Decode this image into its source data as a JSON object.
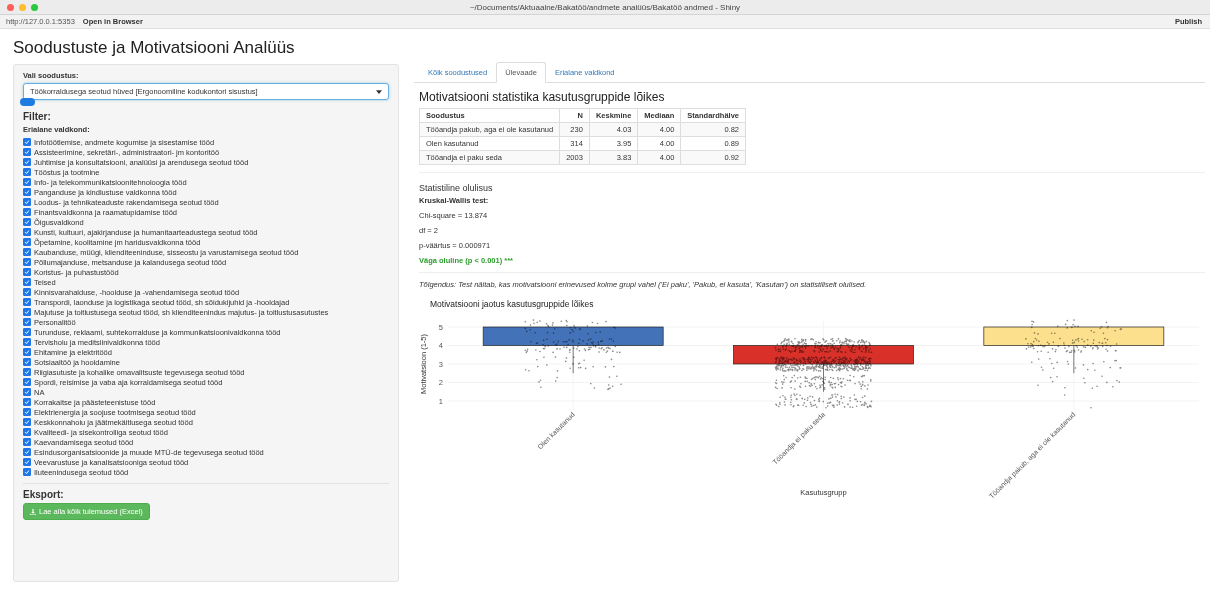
{
  "window": {
    "title": "~/Documents/Aktuaalne/Bakatöö/andmete analüüs/Bakatöö andmed - Shiny"
  },
  "toolbar": {
    "url": "http://127.0.0.1:5353",
    "open_button": "Open in Browser",
    "publish_button": "Publish"
  },
  "page_title": "Soodustuste ja Motivatsiooni Analüüs",
  "sidebar": {
    "select_label": "Vali soodustus:",
    "select_value": "Töökorraldusega seotud hüved [Ergonoomiline kodukontori sisustus]",
    "filter_heading": "Filter:",
    "group_label": "Erialane valdkond:",
    "options": [
      {
        "label": "Infotöötlemise, andmete kogumise ja sisestamise tööd",
        "checked": true
      },
      {
        "label": "Assisteerimine, sekretäri-, administraatori- jm kontoritöö",
        "checked": true
      },
      {
        "label": "Juhtimise ja konsultatsiooni, analüüsi ja arendusega seotud tööd",
        "checked": true
      },
      {
        "label": "Tööstus ja tootmine",
        "checked": true
      },
      {
        "label": "Info- ja telekommunikatsioonitehnoloogia tööd",
        "checked": true
      },
      {
        "label": "Panganduse ja kindlustuse valdkonna tööd",
        "checked": true
      },
      {
        "label": "Loodus- ja tehnikateaduste rakendamisega seotud tööd",
        "checked": true
      },
      {
        "label": "Finantsvaldkonna ja raamatupidamise tööd",
        "checked": true
      },
      {
        "label": "Õigusvaldkond",
        "checked": true
      },
      {
        "label": "Kunsti, kultuuri, ajakirjanduse ja humanitaarteadustega seotud tööd",
        "checked": true
      },
      {
        "label": "Õpetamine, koolitamine jm haridusvaldkonna tööd",
        "checked": true
      },
      {
        "label": "Kaubanduse, müügi, klienditeeninduse, sisseostu ja varustamisega seotud tööd",
        "checked": true
      },
      {
        "label": "Põllumajanduse, metsanduse ja kalandusega seotud tööd",
        "checked": true
      },
      {
        "label": "Koristus- ja puhastustööd",
        "checked": true
      },
      {
        "label": "Teised",
        "checked": true
      },
      {
        "label": "Kinnisvarahalduse, -hoolduse ja -vahendamisega seotud tööd",
        "checked": true
      },
      {
        "label": "Transpordi, laonduse ja logistikaga seotud tööd, sh sõidukijuhid ja -hooldajad",
        "checked": true
      },
      {
        "label": "Majutuse ja toitlustusega seotud tööd, sh klienditeenindus majutus- ja toitlustusasutustes",
        "checked": true
      },
      {
        "label": "Personalitöö",
        "checked": true
      },
      {
        "label": "Turunduse, reklaami, suhtekorralduse ja kommunikatsioonivaldkonna tööd",
        "checked": true
      },
      {
        "label": "Tervishoiu ja meditsiinivaldkonna tööd",
        "checked": true
      },
      {
        "label": "Ehitamine ja elektritööd",
        "checked": true
      },
      {
        "label": "Sotsiaaltöö ja hooldamine",
        "checked": true
      },
      {
        "label": "Riigiasutuste ja kohalike omavalitsuste tegevusega seotud tööd",
        "checked": true
      },
      {
        "label": "Spordi, reisimise ja vaba aja korraldamisega seotud tööd",
        "checked": true
      },
      {
        "label": "NA",
        "checked": true
      },
      {
        "label": "Korrakaitse ja päästeteenistuse tööd",
        "checked": true
      },
      {
        "label": "Elektrienergia ja soojuse tootmisega seotud tööd",
        "checked": true
      },
      {
        "label": "Keskkonnahoiu ja jäätmekäitlusega seotud tööd",
        "checked": true
      },
      {
        "label": "Kvaliteedi- ja sisekontrolliga seotud tööd",
        "checked": true
      },
      {
        "label": "Kaevandamisega seotud tööd",
        "checked": true
      },
      {
        "label": "Esindusorganisatsioonide ja muude MTÜ-de tegevusega seotud tööd",
        "checked": true
      },
      {
        "label": "Veevarustuse ja kanalisatsiooniga seotud tööd",
        "checked": true
      },
      {
        "label": "Iluteenindusega seotud tööd",
        "checked": true
      }
    ],
    "export_heading": "Eksport:",
    "download_button": "Lae alla kõik tulemused (Excel)"
  },
  "tabs": [
    {
      "label": "Kõik soodustused",
      "selected": false
    },
    {
      "label": "Ülevaade",
      "selected": true
    },
    {
      "label": "Erialane valdkond",
      "selected": false
    }
  ],
  "stats_title": "Motivatsiooni statistika kasutusgruppide lõikes",
  "table": {
    "columns": [
      "Soodustus",
      "N",
      "Keskmine",
      "Mediaan",
      "Standardhälve"
    ],
    "rows": [
      [
        "Tööandja pakub, aga ei ole kasutanud",
        "230",
        "4.03",
        "4.00",
        "0.82"
      ],
      [
        "Olen kasutanud",
        "314",
        "3.95",
        "4.00",
        "0.89"
      ],
      [
        "Tööandja ei paku seda",
        "2003",
        "3.83",
        "4.00",
        "0.92"
      ]
    ]
  },
  "significance": {
    "heading": "Statistiline olulisus",
    "test": "Kruskal-Wallis test:",
    "lines": [
      "Chi-square = 13.874",
      "df = 2",
      "p-väärtus = 0.000971"
    ],
    "verdict": "Väga oluline (p < 0.001) ***"
  },
  "interpretation": "Tõlgendus: Test näitab, kas motivatsiooni erinevused kolme grupi vahel ('Ei paku', 'Pakub, ei kasuta', 'Kasutan') on statistiliselt olulised.",
  "plot": {
    "title": "Motivatsiooni jaotus kasutusgruppide lõikes",
    "xlabel": "Kasutusgrupp",
    "ylabel": "Motivatsioon (1-5)",
    "yticks": [
      "5",
      "4",
      "3",
      "2",
      "1"
    ],
    "groups": [
      {
        "label": "Olen kasutanud",
        "color": "#4472b8"
      },
      {
        "label": "Tööandja ei paku seda",
        "color": "#d9302a"
      },
      {
        "label": "Tööandja pakub, aga ei ole kasutanud",
        "color": "#fde08d"
      }
    ]
  }
}
